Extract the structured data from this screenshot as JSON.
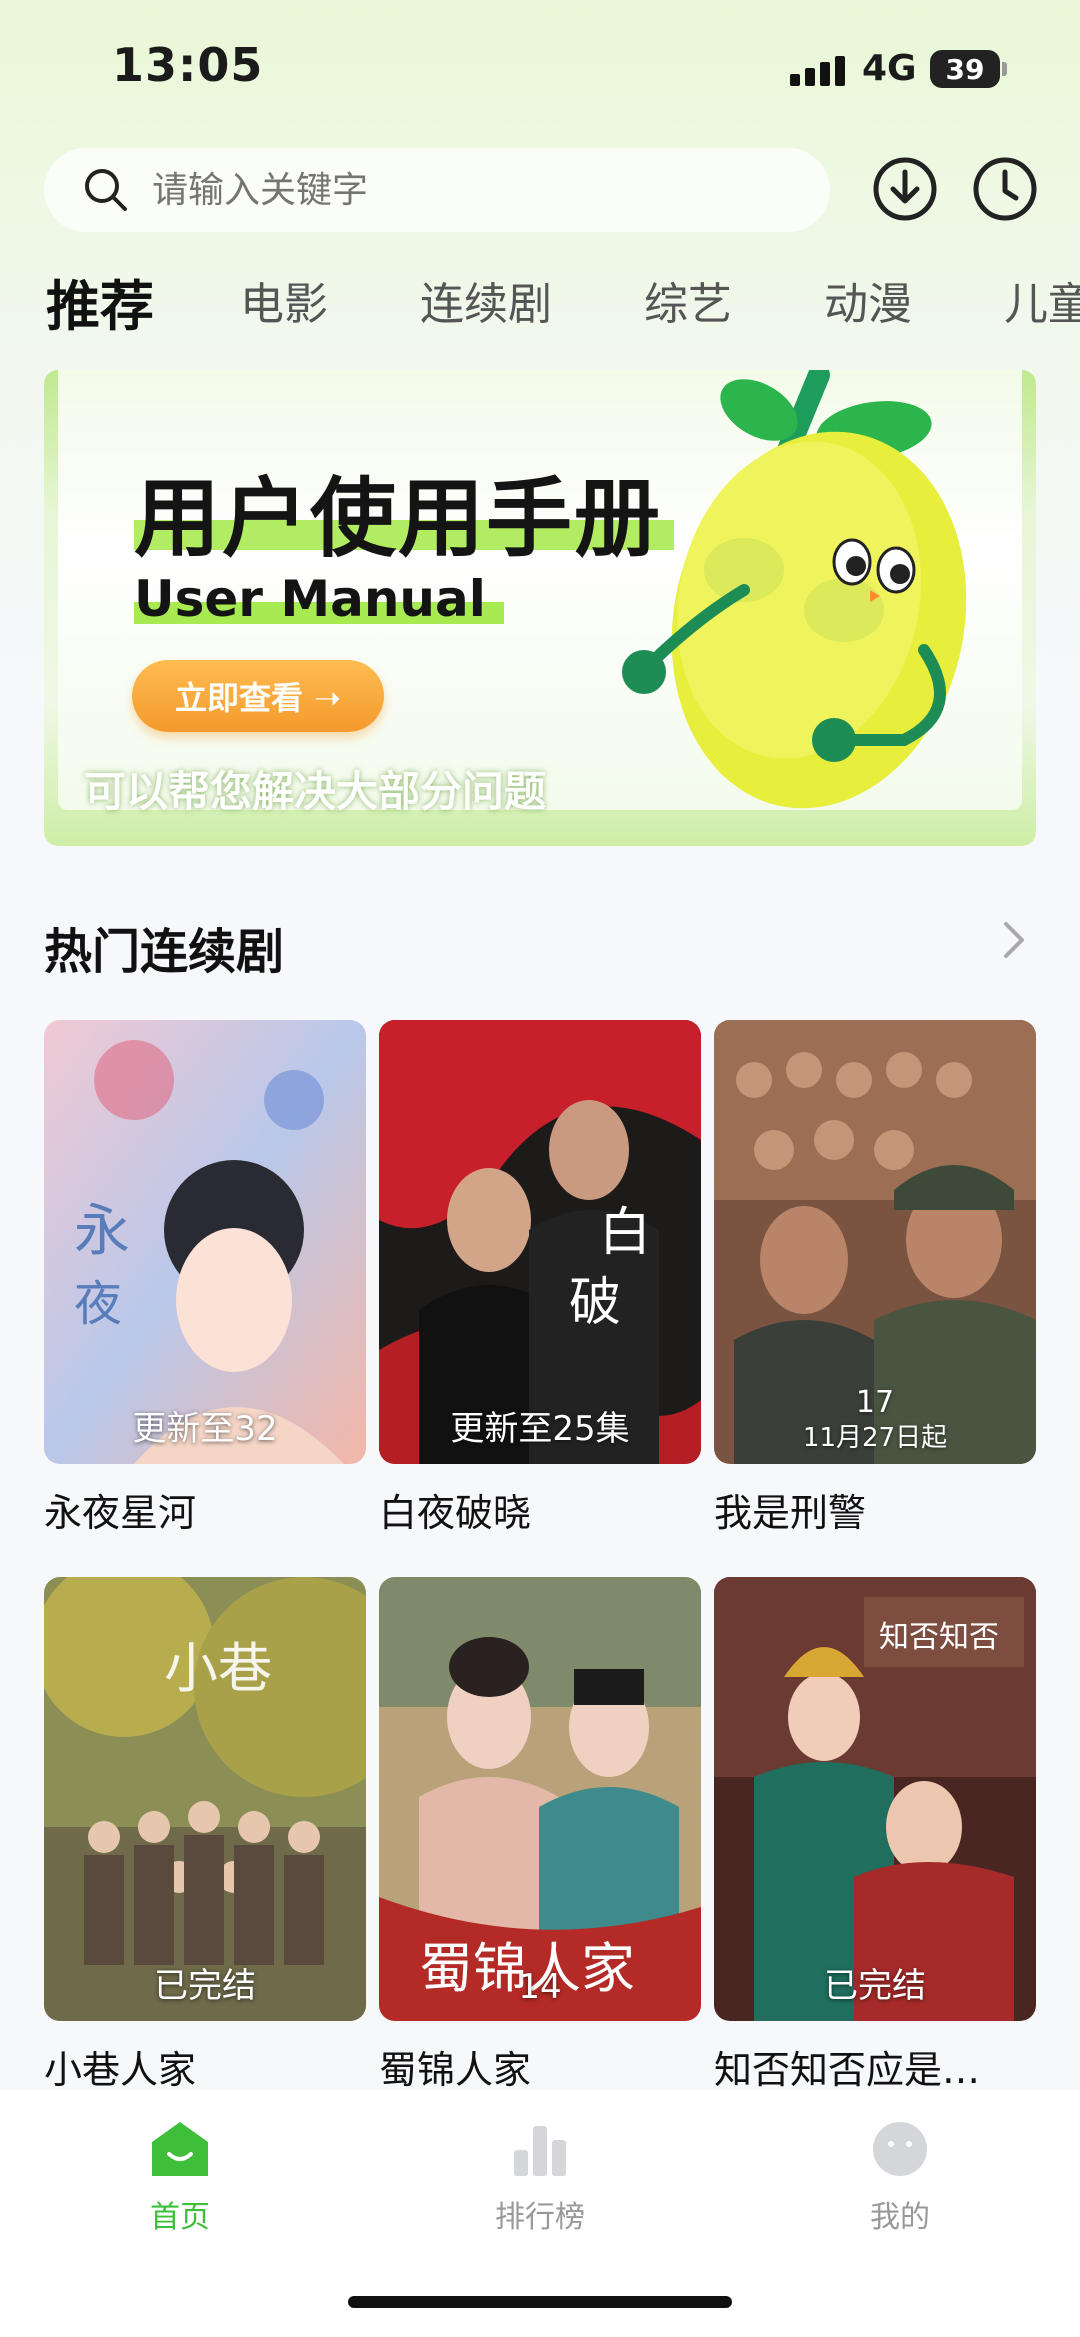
{
  "status_bar": {
    "time": "13:05",
    "network": "4G",
    "battery": "39"
  },
  "search": {
    "placeholder": "请输入关键字"
  },
  "header_icons": [
    "download-icon",
    "history-icon"
  ],
  "tabs": [
    {
      "label": "推荐",
      "active": true
    },
    {
      "label": "电影"
    },
    {
      "label": "连续剧"
    },
    {
      "label": "综艺"
    },
    {
      "label": "动漫"
    },
    {
      "label": "儿童"
    }
  ],
  "banner": {
    "title": "用户使用手册",
    "subtitle": "User Manual",
    "button": "立即查看 ➝",
    "caption": "可以帮您解决大部分问题"
  },
  "section": {
    "title": "热门连续剧"
  },
  "shows": [
    {
      "title": "永夜星河",
      "badge": "更新至32"
    },
    {
      "title": "白夜破晓",
      "badge": "更新至25集"
    },
    {
      "title": "我是刑警",
      "badge": "11月27日起",
      "number": "17"
    },
    {
      "title": "小巷人家",
      "badge": "已完结"
    },
    {
      "title": "蜀锦人家",
      "badge": "14"
    },
    {
      "title": "知否知否应是…",
      "badge": "已完结"
    }
  ],
  "bottom_nav": [
    {
      "label": "首页",
      "icon": "home-icon",
      "active": true
    },
    {
      "label": "排行榜",
      "icon": "ranking-icon"
    },
    {
      "label": "我的",
      "icon": "profile-icon"
    }
  ],
  "colors": {
    "accent": "#3fbe3a",
    "button": "#f49a2c",
    "highlight": "#a8ea52"
  }
}
